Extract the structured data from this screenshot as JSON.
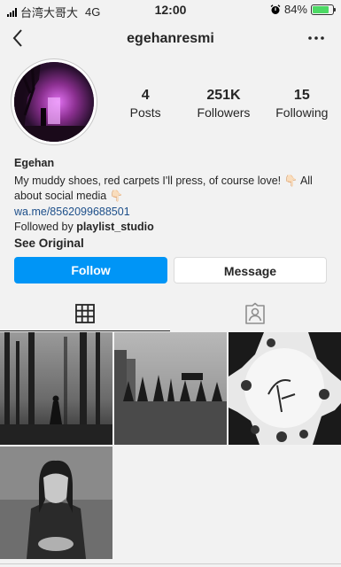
{
  "status_bar": {
    "carrier": "台湾大哥大",
    "network": "4G",
    "time": "12:00",
    "battery": "84%",
    "battery_level": 0.84
  },
  "nav": {
    "title": "egehanresmi",
    "back_icon": "chevron-left-icon",
    "more_icon": "more-horizontal-icon"
  },
  "profile": {
    "stats": [
      {
        "value": "4",
        "label": "Posts"
      },
      {
        "value": "251K",
        "label": "Followers"
      },
      {
        "value": "15",
        "label": "Following"
      }
    ]
  },
  "bio": {
    "name": "Egehan",
    "text": "My muddy shoes, red carpets I'll press, of course love! 👇🏻 All about social media 👇🏻",
    "link": "wa.me/8562099688501",
    "followed_prefix": "Followed by ",
    "followed_user": "playlist_studio",
    "see_original": "See Original"
  },
  "actions": {
    "follow": "Follow",
    "message": "Message"
  },
  "tabs": [
    {
      "icon": "grid-icon",
      "active": true
    },
    {
      "icon": "tagged-person-icon",
      "active": false
    }
  ],
  "colors": {
    "accent": "#0095f6",
    "link": "#1d4f8a",
    "battery": "#4cd964"
  }
}
